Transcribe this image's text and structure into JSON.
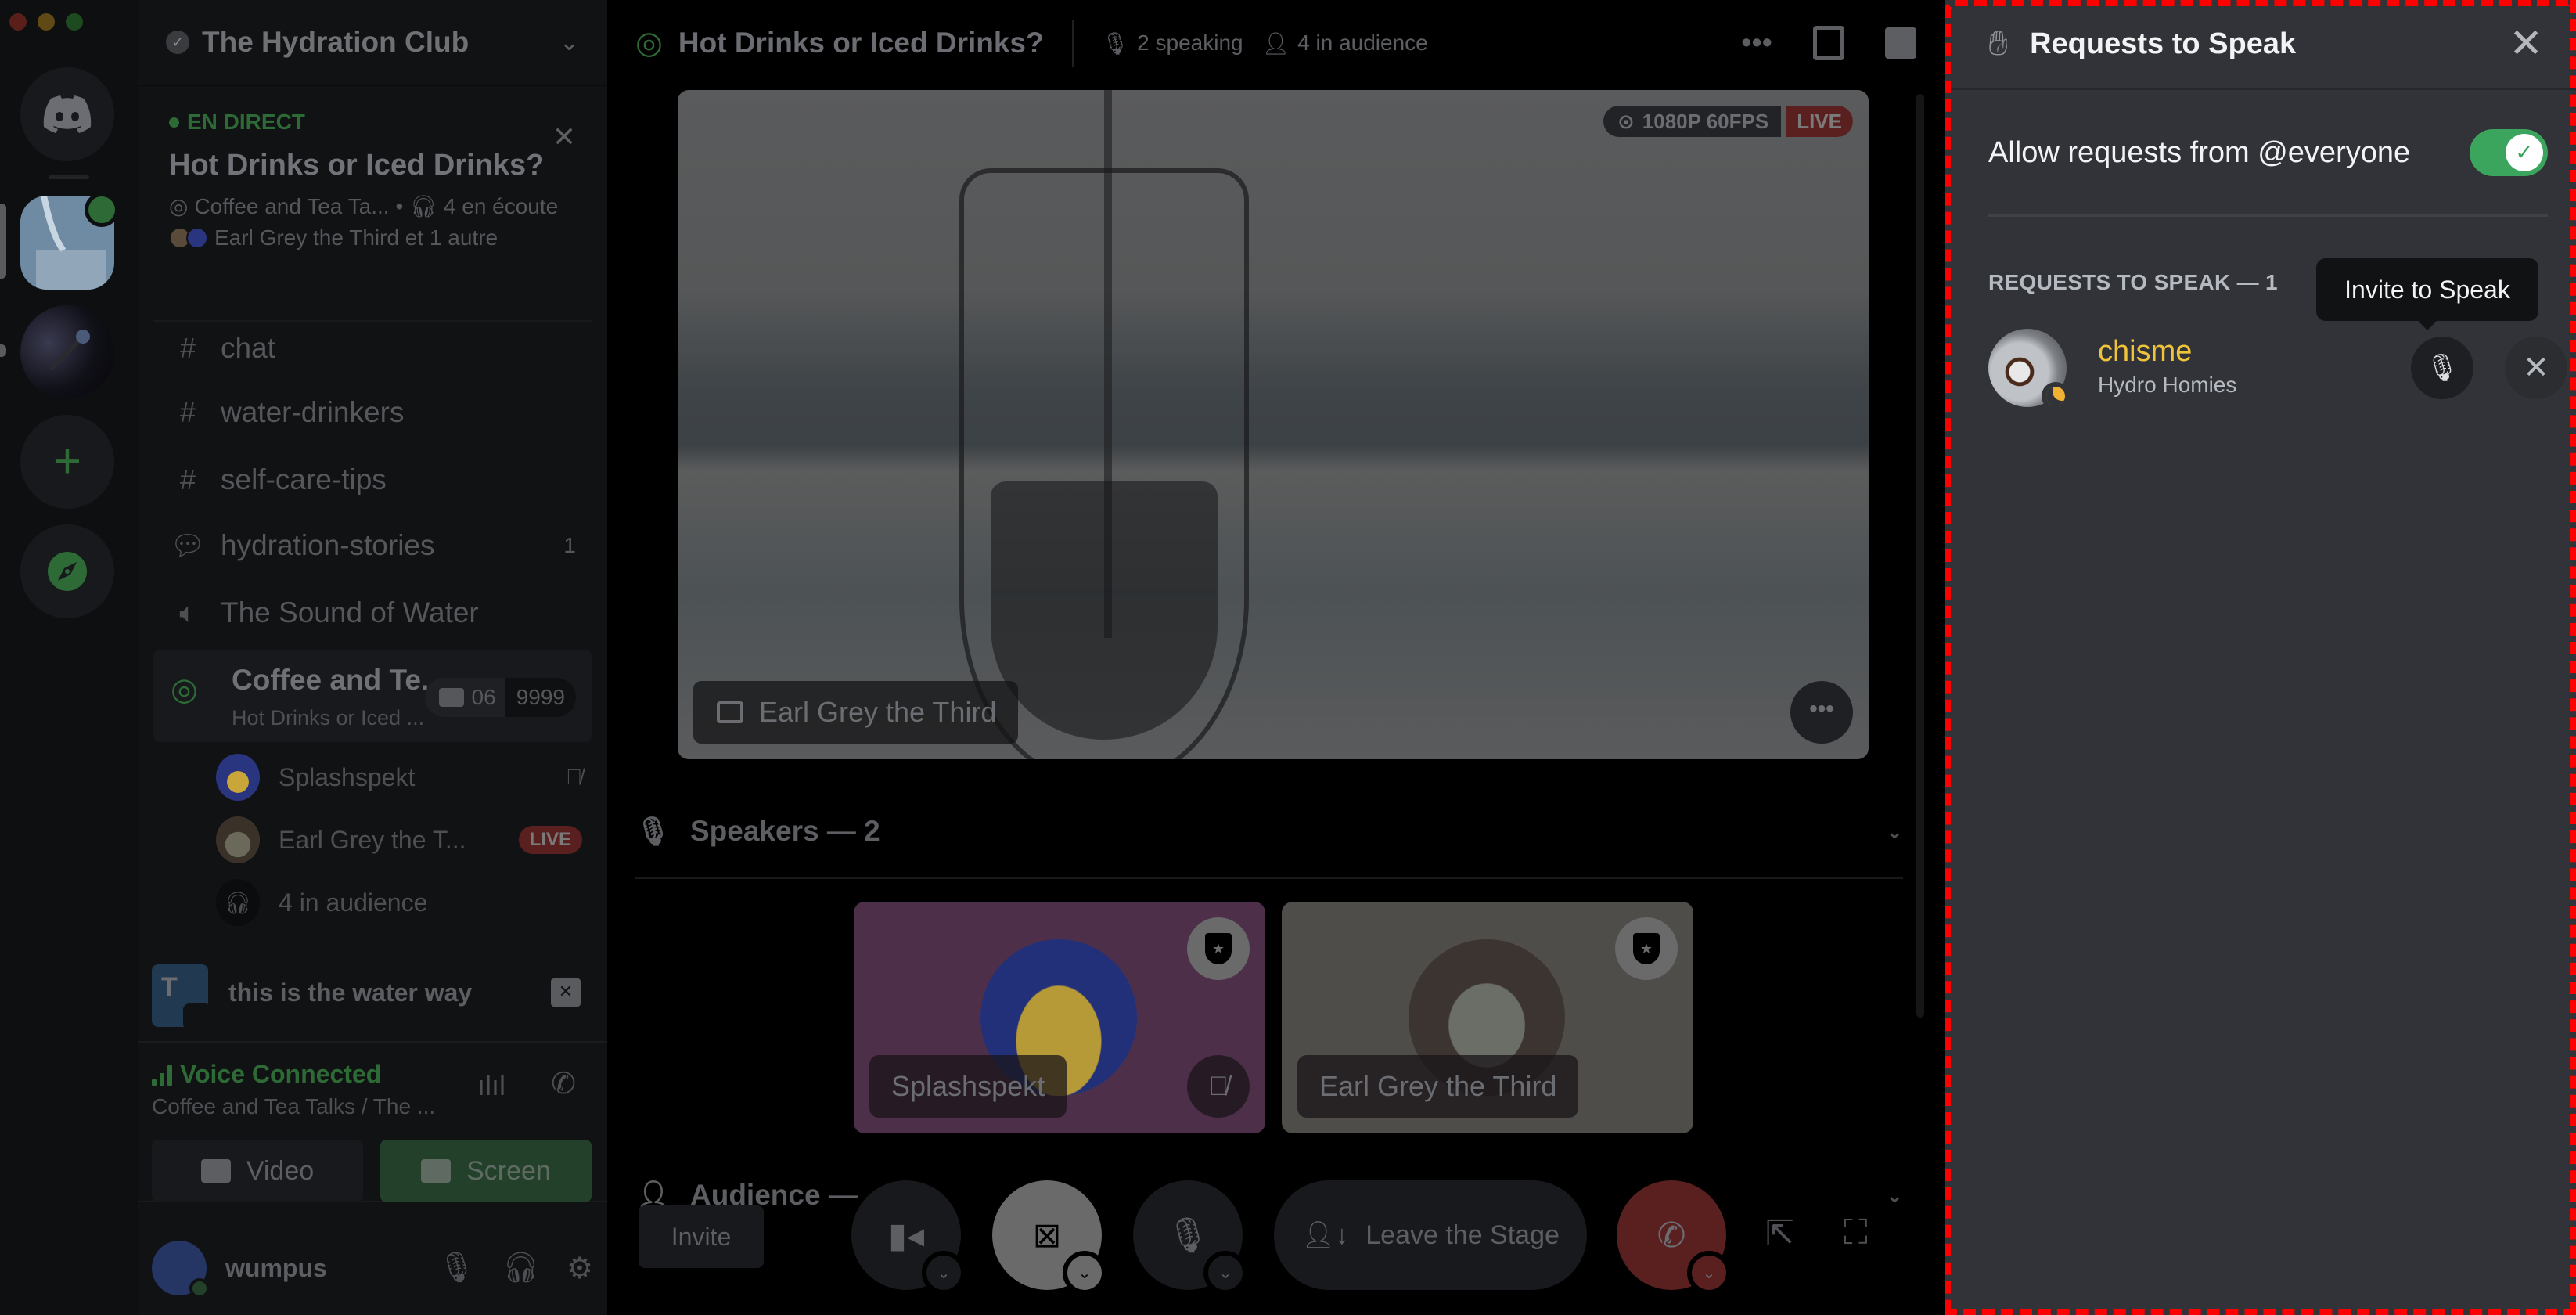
{
  "window": {
    "traffic_lights": [
      "#5a1f1a",
      "#5f4915",
      "#1e4a1f"
    ]
  },
  "server_rail": {
    "items": [
      {
        "name": "Direct Messages",
        "icon": "discord-logo-icon"
      },
      {
        "name": "The Hydration Club",
        "icon": "server-water-icon",
        "stage_badge": true,
        "selected": true
      },
      {
        "name": "Microphone server",
        "icon": "server-mic-icon"
      },
      {
        "name": "Add a Server",
        "icon": "plus-icon"
      },
      {
        "name": "Explore Discoverable Servers",
        "icon": "compass-icon"
      }
    ]
  },
  "sidebar": {
    "guild_name": "The Hydration Club",
    "live_event": {
      "tag": "EN DIRECT",
      "title": "Hot Drinks or Iced Drinks?",
      "channel": "Coffee and Tea Ta...",
      "separator": "•",
      "listeners": "4 en écoute",
      "speakers": "Earl Grey the Third et 1 autre"
    },
    "channels": [
      {
        "name": "chat",
        "type": "text-locked"
      },
      {
        "name": "water-drinkers",
        "type": "text-locked"
      },
      {
        "name": "self-care-tips",
        "type": "text-locked"
      },
      {
        "name": "hydration-stories",
        "type": "forum",
        "count": "1"
      },
      {
        "name": "The Sound of Water",
        "type": "voice-locked"
      }
    ],
    "active_stage": {
      "name": "Coffee and Te...",
      "topic": "Hot Drinks or Iced ...",
      "video_count": "06",
      "limit": "9999"
    },
    "stage_members": [
      {
        "name": "Splashspekt",
        "status": "muted"
      },
      {
        "name": "Earl Grey the T...",
        "status": "LIVE"
      },
      {
        "name": "4 in audience",
        "status": ""
      }
    ],
    "stream_strip": {
      "avatar_letter": "T",
      "title": "this is the water way"
    },
    "voice": {
      "status": "Voice Connected",
      "location": "Coffee and Tea Talks / The ...",
      "video_label": "Video",
      "screen_label": "Screen"
    },
    "user": {
      "name": "wumpus"
    }
  },
  "main": {
    "header": {
      "title": "Hot Drinks or Iced Drinks?",
      "speaking": "2 speaking",
      "audience": "4 in audience"
    },
    "stream": {
      "quality": "1080P 60FPS",
      "live": "LIVE",
      "streamer": "Earl Grey the Third"
    },
    "speakers_section": {
      "title": "Speakers — 2",
      "speakers": [
        {
          "name": "Splashspekt",
          "muted": true
        },
        {
          "name": "Earl Grey the Third",
          "muted": false
        }
      ]
    },
    "audience_section": {
      "title": "Audience —"
    },
    "controls": {
      "invite_label": "Invite",
      "leave_label": "Leave the Stage"
    }
  },
  "panel": {
    "title": "Requests to Speak",
    "allow_label": "Allow requests from @everyone",
    "allow_enabled": true,
    "section_title": "REQUESTS TO SPEAK — 1",
    "requests": [
      {
        "name": "chisme",
        "role": "Hydro Homies",
        "name_color": "#f0c43a",
        "status": "idle"
      }
    ],
    "tooltip": "Invite to Speak"
  },
  "colors": {
    "accent_green": "#3ba55d",
    "live_red": "#5a2020",
    "panel_bg": "#313338",
    "highlight_border": "#ff0000"
  }
}
